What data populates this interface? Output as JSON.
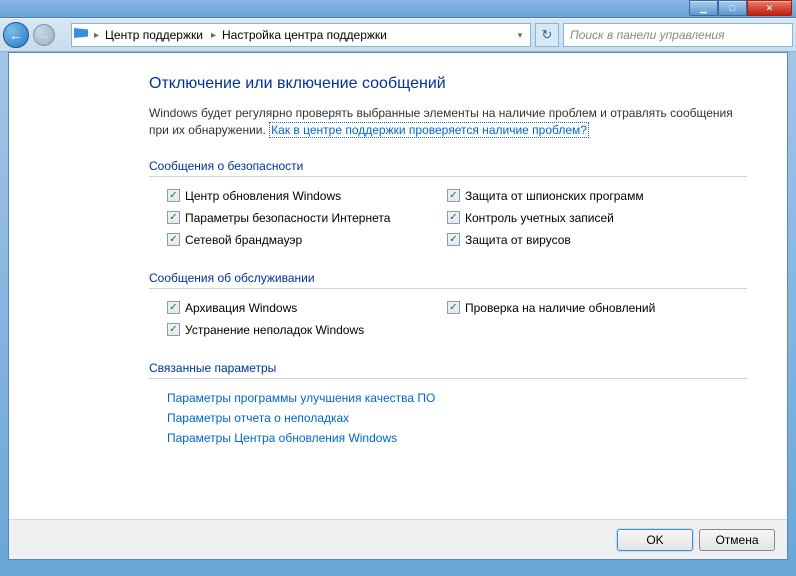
{
  "window": {
    "breadcrumb": {
      "level1": "Центр поддержки",
      "level2": "Настройка центра поддержки"
    },
    "search_placeholder": "Поиск в панели управления"
  },
  "page": {
    "title": "Отключение или включение сообщений",
    "intro_text": "Windows будет регулярно проверять выбранные элементы на наличие проблем и отравлять сообщения при их обнаружении. ",
    "intro_link": "Как в центре поддержки проверяется наличие проблем?"
  },
  "sections": {
    "security": {
      "title": "Сообщения о безопасности",
      "items": [
        {
          "label": "Центр обновления Windows",
          "checked": true
        },
        {
          "label": "Защита от шпионских программ",
          "checked": true
        },
        {
          "label": "Параметры безопасности Интернета",
          "checked": true
        },
        {
          "label": "Контроль учетных записей",
          "checked": true
        },
        {
          "label": "Сетевой брандмауэр",
          "checked": true
        },
        {
          "label": "Защита от вирусов",
          "checked": true
        }
      ]
    },
    "maintenance": {
      "title": "Сообщения об обслуживании",
      "items": [
        {
          "label": "Архивация Windows",
          "checked": true
        },
        {
          "label": "Проверка на наличие обновлений",
          "checked": true
        },
        {
          "label": "Устранение неполадок Windows",
          "checked": true
        }
      ]
    },
    "related": {
      "title": "Связанные параметры",
      "links": [
        "Параметры программы улучшения качества ПО",
        "Параметры отчета о неполадках",
        "Параметры Центра обновления Windows"
      ]
    }
  },
  "footer": {
    "ok": "OK",
    "cancel": "Отмена"
  }
}
